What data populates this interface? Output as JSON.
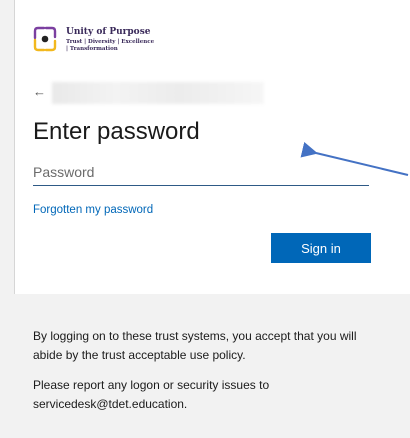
{
  "brand": {
    "name": "Unity of Purpose",
    "tagline": "Trust | Diversity | Excellence | Transformation"
  },
  "colors": {
    "accent": "#0067b8",
    "input_underline": "#2e5a86",
    "annotation_arrow": "#4472c4",
    "logo_purple": "#7b3fa0",
    "logo_yellow": "#f2b81d",
    "logo_dot": "#222222"
  },
  "nav": {
    "back_icon": "←"
  },
  "form": {
    "title": "Enter password",
    "password_placeholder": "Password",
    "password_value": "",
    "forgot_link": "Forgotten my password",
    "signin_label": "Sign in"
  },
  "footer": {
    "policy_text": "By logging on to these trust systems, you accept that you will abide by the trust acceptable use policy.",
    "support_text": "Please report any logon or security issues to servicedesk@tdet.education."
  }
}
